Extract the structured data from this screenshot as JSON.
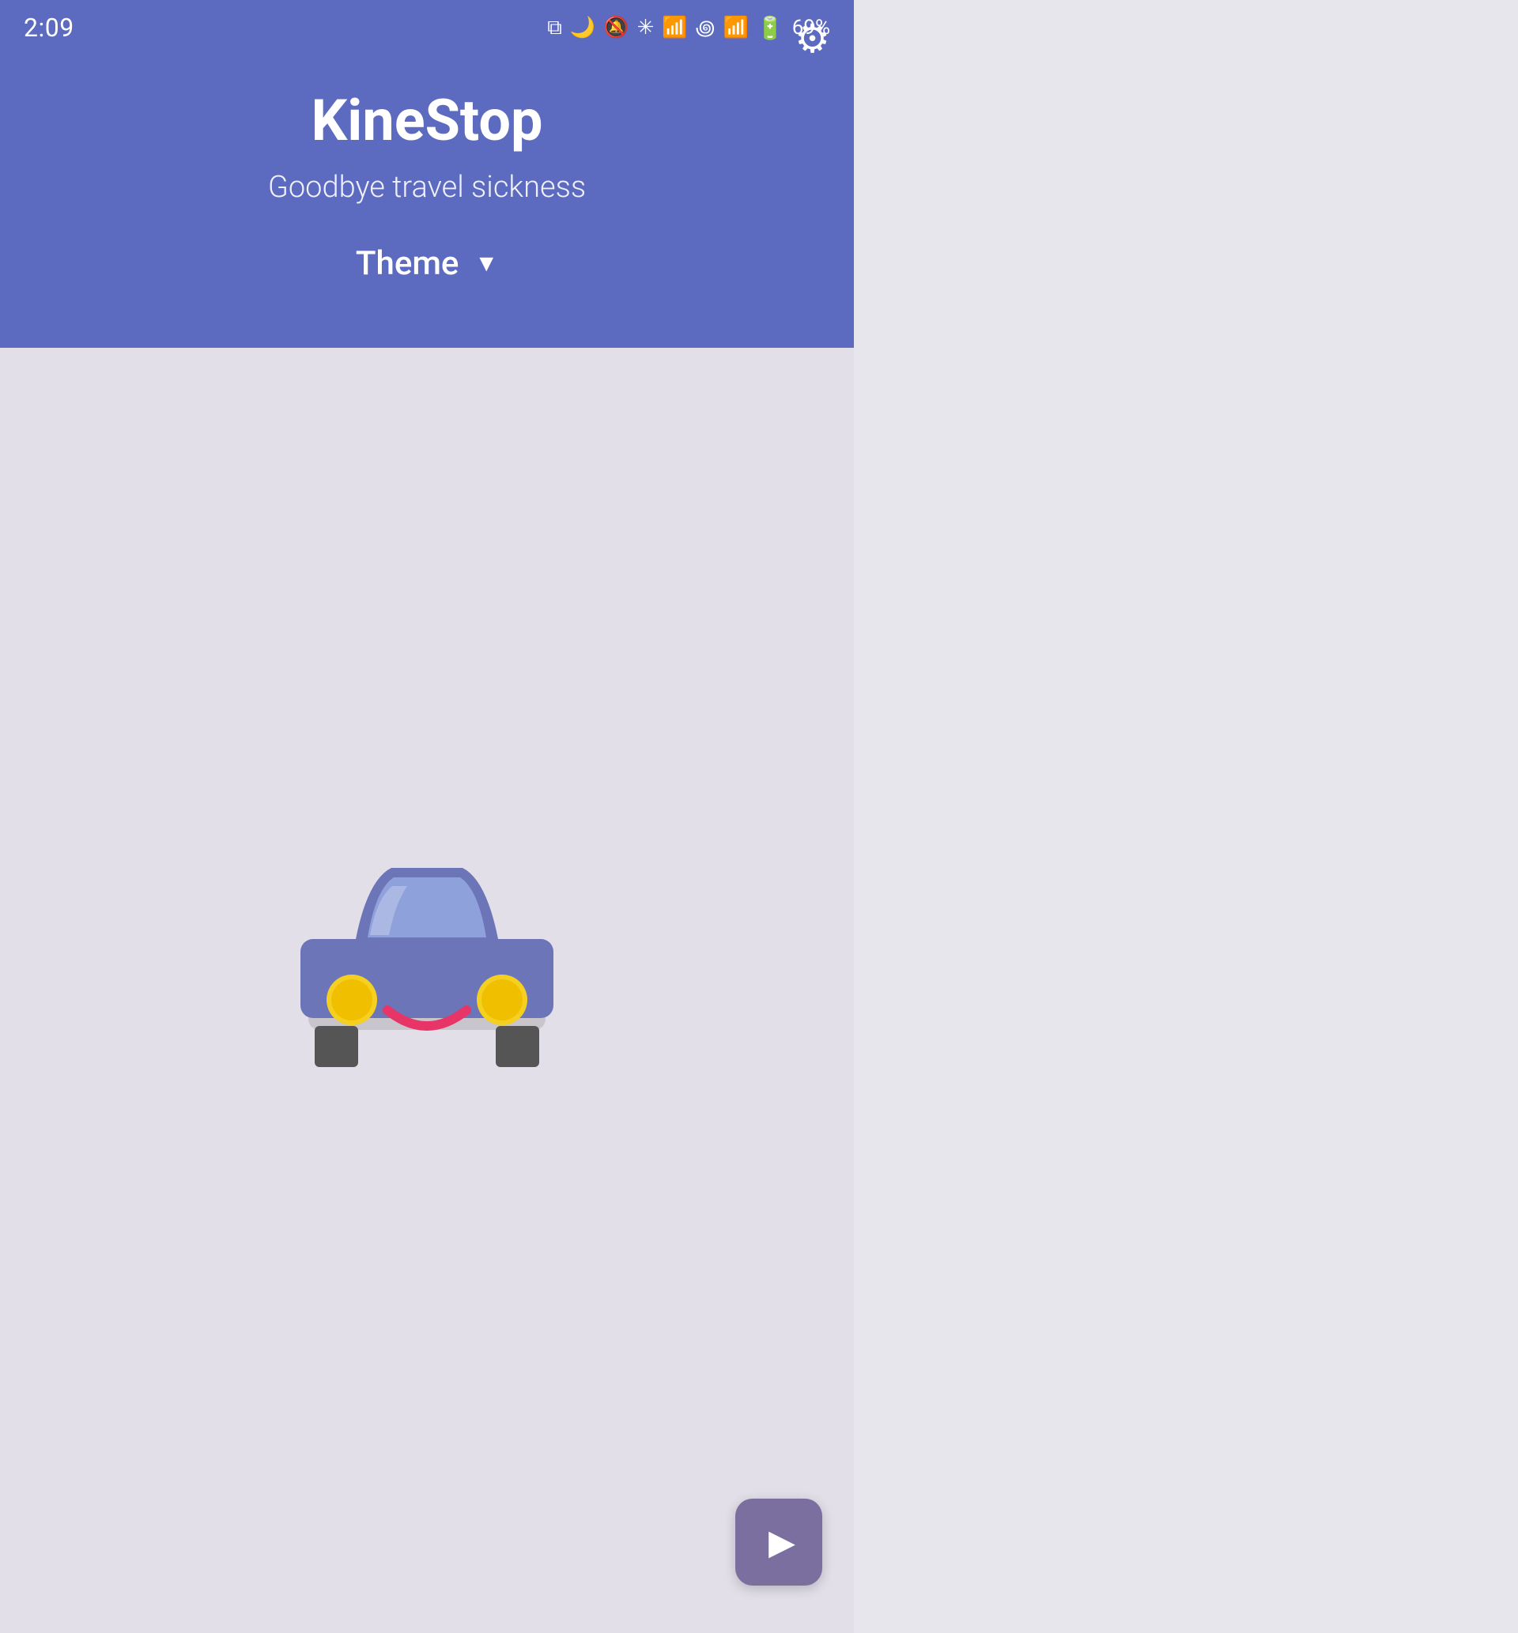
{
  "statusBar": {
    "time": "2:09",
    "battery": "69%",
    "icons": [
      "copy-icon",
      "moon-icon",
      "mute-icon",
      "bluetooth-icon",
      "wifi-icon",
      "network-icon",
      "signal-icon",
      "battery-icon"
    ]
  },
  "header": {
    "backgroundColor": "#5c6bc0",
    "title": "KineStop",
    "subtitle": "Goodbye travel sickness",
    "themeLabel": "Theme",
    "themeArrow": "▼",
    "settingsIconLabel": "⚙"
  },
  "main": {
    "backgroundColor": "#e2dfe9"
  },
  "playButton": {
    "backgroundColor": "#7b6fa0",
    "icon": "▶"
  }
}
